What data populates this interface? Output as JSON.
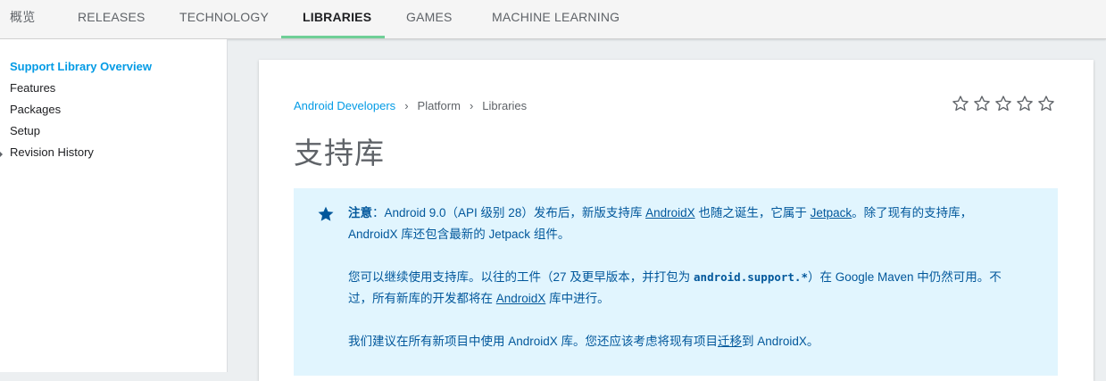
{
  "tabs": [
    {
      "label": "概览"
    },
    {
      "label": "RELEASES"
    },
    {
      "label": "TECHNOLOGY"
    },
    {
      "label": "LIBRARIES",
      "active": true
    },
    {
      "label": "GAMES"
    },
    {
      "label": "MACHINE LEARNING"
    }
  ],
  "sidebar": {
    "items": [
      {
        "label": "Support Library Overview",
        "active": true
      },
      {
        "label": "Features"
      },
      {
        "label": "Packages"
      },
      {
        "label": "Setup"
      },
      {
        "label": "Revision History"
      }
    ]
  },
  "breadcrumb": {
    "items": [
      "Android Developers",
      "Platform",
      "Libraries"
    ],
    "separator": ">"
  },
  "rating": {
    "stars": 5,
    "filled": 0
  },
  "page": {
    "title": "支持库"
  },
  "note": {
    "label": "注意",
    "p1_a": "：Android 9.0（API 级别 28）发布后，新版支持库 ",
    "p1_link1": "AndroidX",
    "p1_b": " 也随之诞生，它属于 ",
    "p1_link2": "Jetpack",
    "p1_c": "。除了现有的支持库，",
    "p1_line2": "AndroidX 库还包含最新的 Jetpack 组件。",
    "p2_a": "您可以继续使用支持库。以往的工件（27 及更早版本，并打包为 ",
    "p2_code": "android.support.*",
    "p2_b": "）在 Google Maven 中仍然可用。不",
    "p2_line2_a": "过，所有新库的开发都将在 ",
    "p2_line2_link": "AndroidX",
    "p2_line2_b": " 库中进行。",
    "p3_a": "我们建议在所有新项目中使用 AndroidX 库。您还应该考虑将现有项目",
    "p3_link": "迁移",
    "p3_b": "到 AndroidX。"
  },
  "colors": {
    "accent": "#039be5",
    "tab_underline": "#6fcf97",
    "note_bg": "#e1f5fe",
    "note_text": "#01579b"
  }
}
